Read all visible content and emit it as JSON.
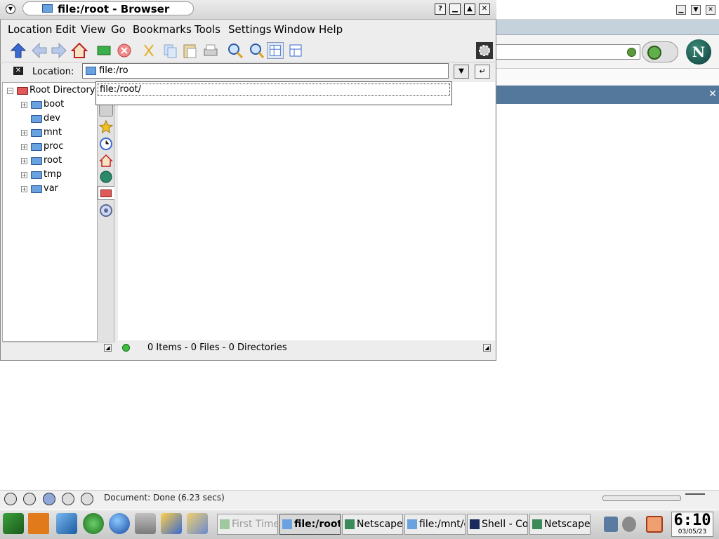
{
  "browser": {
    "title": "file:/root - Browser",
    "window_buttons": [
      "?",
      "▁",
      "▲",
      "✕"
    ],
    "menu": [
      "Location",
      "Edit",
      "View",
      "Go",
      "Bookmarks",
      "Tools",
      "Settings",
      "Window",
      "Help"
    ],
    "toolbar_icons": [
      "up-arrow-icon",
      "back-arrow-icon",
      "forward-arrow-icon",
      "home-icon",
      "reload-icon",
      "stop-icon",
      "cut-icon",
      "copy-icon",
      "paste-icon",
      "print-icon",
      "zoom-in-icon",
      "zoom-out-icon",
      "icon-view-icon",
      "detail-view-icon",
      "gear-icon"
    ],
    "location_label": "Location:",
    "location_value": "file:/ro",
    "autocomplete_item": "file:/root/",
    "tree": {
      "root": "Root Directory",
      "items": [
        "boot",
        "dev",
        "mnt",
        "proc",
        "root",
        "tmp",
        "var"
      ]
    },
    "sidebar_tabs": [
      "search-icon",
      "bookmarks-star-icon",
      "history-clock-icon",
      "home-icon",
      "network-globe-icon",
      "root-folder-icon",
      "services-icon"
    ],
    "status_text": "0 Items - 0 Files - 0 Directories"
  },
  "netscape": {
    "logo_letter": "N",
    "status_text": "Document: Done (6.23 secs)",
    "close_tab": "✕"
  },
  "taskbar": {
    "tasks": [
      "First Time",
      "file:/root",
      "Netscape",
      "file:/mnt/c",
      "Shell - Co",
      "Netscape"
    ],
    "clock_time": "6:10",
    "clock_date": "03/05/23"
  },
  "colors": {
    "netscape_tabstrip": "#54789c",
    "folder_blue": "#6aa2e0",
    "status_green": "#3ac03a"
  }
}
